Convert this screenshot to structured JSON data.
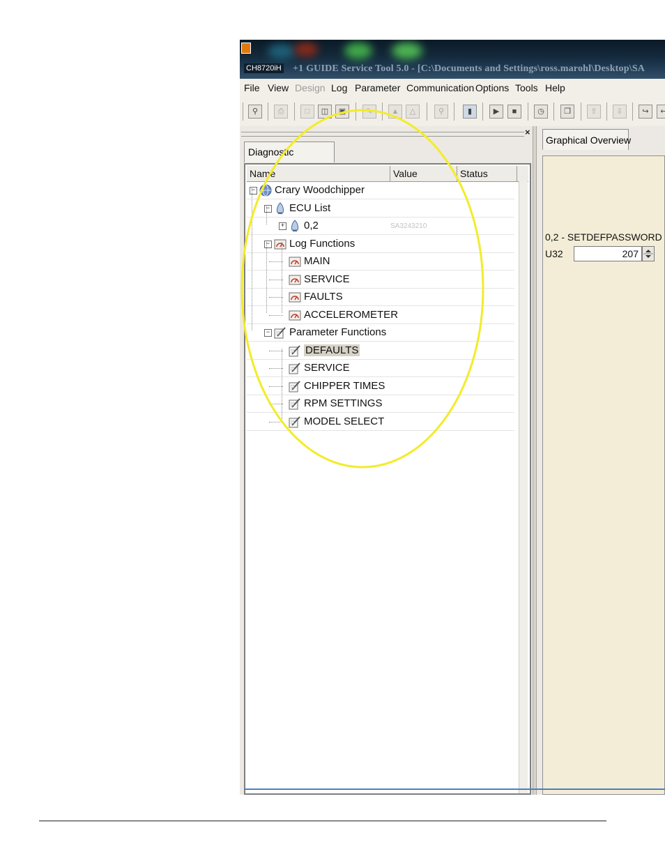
{
  "window": {
    "title_badge": "CH8720iH",
    "title": "+1 GUIDE Service Tool 5.0 - [C:\\Documents and Settings\\ross.marohl\\Desktop\\SA"
  },
  "menu": {
    "items": [
      {
        "label": "File"
      },
      {
        "label": "View"
      },
      {
        "label": "Design"
      },
      {
        "label": "Log"
      },
      {
        "label": "Parameter"
      },
      {
        "label": "Communication"
      },
      {
        "label": "Options"
      },
      {
        "label": "Tools"
      },
      {
        "label": "Help"
      }
    ]
  },
  "left_pane": {
    "close_glyph": "×",
    "tab_label": "Diagnostic Navigator",
    "columns": [
      "Name",
      "Value",
      "Status"
    ],
    "tree": [
      {
        "label": "Crary Woodchipper",
        "icon": "globe-icon",
        "expander": "−"
      },
      {
        "label": "ECU List",
        "icon": "ecu-icon",
        "expander": "−"
      },
      {
        "label": "0,2",
        "icon": "ecu-icon",
        "expander": "+",
        "value": "SA3243210"
      },
      {
        "label": "Log Functions",
        "icon": "log-gauge-icon",
        "expander": "−"
      },
      {
        "label": "MAIN",
        "icon": "log-gauge-icon"
      },
      {
        "label": "SERVICE",
        "icon": "log-gauge-icon"
      },
      {
        "label": "FAULTS",
        "icon": "log-gauge-icon"
      },
      {
        "label": "ACCELEROMETER",
        "icon": "log-gauge-icon"
      },
      {
        "label": "Parameter Functions",
        "icon": "pencil-paper-icon",
        "expander": "−"
      },
      {
        "label": "DEFAULTS",
        "icon": "pencil-paper-icon",
        "selected": true
      },
      {
        "label": "SERVICE",
        "icon": "pencil-paper-icon"
      },
      {
        "label": "CHIPPER TIMES",
        "icon": "pencil-paper-icon"
      },
      {
        "label": "RPM SETTINGS",
        "icon": "pencil-paper-icon"
      },
      {
        "label": "MODEL SELECT",
        "icon": "pencil-paper-icon"
      }
    ]
  },
  "right_pane": {
    "tab_label": "Graphical Overview",
    "param_title": "0,2 - SETDEFPASSWORD",
    "param_type": "U32",
    "param_value": "207"
  },
  "colors": {
    "highlight": "#f2ec2a",
    "graph_background": "#f3edd7",
    "selection": "#d6d2c6"
  }
}
